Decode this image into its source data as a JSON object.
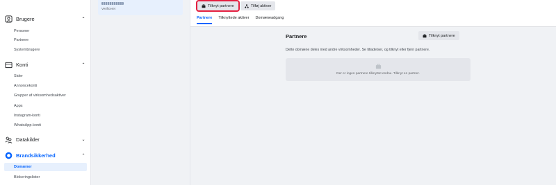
{
  "sidebar": {
    "groups": [
      {
        "label": "Brugere",
        "chevron": "up",
        "icon": "users-icon"
      },
      {
        "label": "Konti",
        "chevron": "up",
        "icon": "folder-icon"
      },
      {
        "label": "Datakilder",
        "chevron": "down",
        "icon": "people-group-icon"
      },
      {
        "label": "Brandsikkerhed",
        "chevron": "up",
        "icon": "shield-icon"
      }
    ],
    "brugere_items": [
      "Personer",
      "Partnere",
      "Systembrugere"
    ],
    "konti_items": [
      "Sider",
      "Annoncekonti",
      "Grupper af virksomhedsaktiver",
      "Apps",
      "Instagram-konti",
      "WhatsApp-konti"
    ],
    "brand_items": [
      "Domæner",
      "Blokeringslister"
    ],
    "selected_item": "Domæner"
  },
  "asset_card": {
    "status": "Verificeret"
  },
  "toolbar": {
    "connect_partner_label": "Tilknyt partnere",
    "add_assets_label": "Tilføj aktiver"
  },
  "tabs": [
    "Partnere",
    "Tilknyttede aktiver",
    "Domæneadgang"
  ],
  "panel": {
    "title": "Partnere",
    "button_label": "Tilknyt partnere",
    "description": "Dette domæne deles med andre virksomheder. Se tilladelser, og tilknyt eller fjern partnere.",
    "empty_text": "Der er ingen partnere tilknyttet endnu. Tilknyt en partner."
  },
  "colors": {
    "accent": "#0866ff",
    "highlight": "#e41e3f"
  }
}
